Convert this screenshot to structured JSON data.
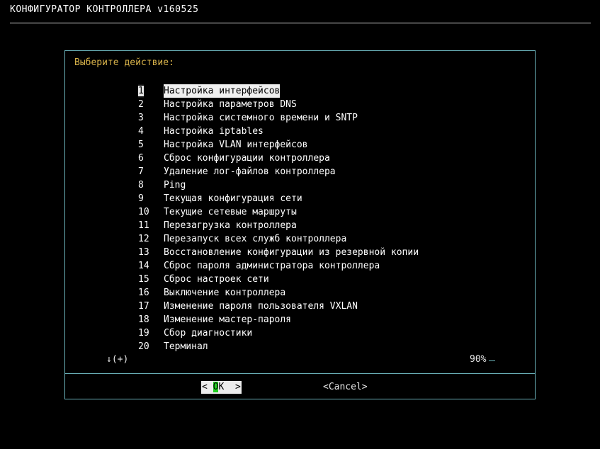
{
  "header": {
    "title": "КОНФИГУРАТОР КОНТРОЛЛЕРА v160525"
  },
  "dialog": {
    "prompt": "Выберите действие:",
    "selected_index": 0,
    "items": [
      {
        "key": "1",
        "label": "Настройка интерфейсов"
      },
      {
        "key": "2",
        "label": "Настройка параметров DNS"
      },
      {
        "key": "3",
        "label": "Настройка системного времени и SNTP"
      },
      {
        "key": "4",
        "label": "Настройка iptables"
      },
      {
        "key": "5",
        "label": "Настройка VLAN интерфейсов"
      },
      {
        "key": "6",
        "label": "Сброс конфигурации контроллера"
      },
      {
        "key": "7",
        "label": "Удаление лог-файлов контроллера"
      },
      {
        "key": "8",
        "label": "Ping"
      },
      {
        "key": "9",
        "label": "Текущая конфигурация сети"
      },
      {
        "key": "10",
        "label": "Текущие сетевые маршруты"
      },
      {
        "key": "11",
        "label": "Перезагрузка контроллера"
      },
      {
        "key": "12",
        "label": "Перезапуск всех служб контроллера"
      },
      {
        "key": "13",
        "label": "Восстановление конфигурации из резервной копии"
      },
      {
        "key": "14",
        "label": "Сброс пароля администратора контроллера"
      },
      {
        "key": "15",
        "label": "Сброс настроек сети"
      },
      {
        "key": "16",
        "label": "Выключение контроллера"
      },
      {
        "key": "17",
        "label": "Изменение пароля пользователя VXLAN"
      },
      {
        "key": "18",
        "label": "Изменение мастер-пароля"
      },
      {
        "key": "19",
        "label": "Сбор диагностики"
      },
      {
        "key": "20",
        "label": "Терминал"
      }
    ],
    "more_indicator": "↓(+)",
    "scroll_percent": "90%",
    "scroll_fraction": 0.9,
    "ok_left": "< ",
    "ok_hot": "O",
    "ok_rest": "K  >",
    "cancel_label": "<Cancel>"
  },
  "colors": {
    "background": "#000000",
    "border": "#6ab0b8",
    "prompt": "#d8b24a",
    "hotkey": "#22d022",
    "selection": "#f0f0f0"
  }
}
